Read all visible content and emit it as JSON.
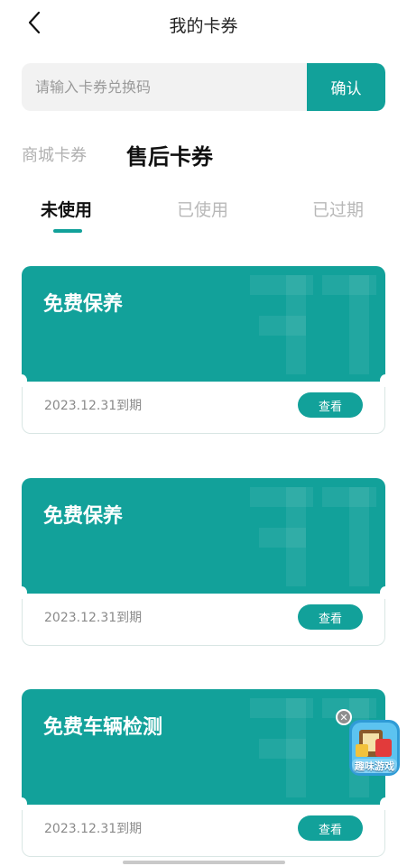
{
  "header": {
    "title": "我的卡券"
  },
  "redeem": {
    "placeholder": "请输入卡券兑换码",
    "confirm_label": "确认"
  },
  "categories": [
    {
      "label": "商城卡券",
      "active": false
    },
    {
      "label": "售后卡券",
      "active": true
    }
  ],
  "status_tabs": [
    {
      "label": "未使用",
      "active": true
    },
    {
      "label": "已使用",
      "active": false
    },
    {
      "label": "已过期",
      "active": false
    }
  ],
  "coupons": [
    {
      "name": "免费保养",
      "expiry": "2023.12.31到期",
      "button": "查看"
    },
    {
      "name": "免费保养",
      "expiry": "2023.12.31到期",
      "button": "查看"
    },
    {
      "name": "免费车辆检测",
      "expiry": "2023.12.31到期",
      "button": "查看"
    }
  ],
  "floating_widget": {
    "label": "趣味游戏",
    "icon": "game-icon"
  },
  "colors": {
    "accent": "#12a19a",
    "text_primary": "#111111",
    "text_muted": "#b0b0b0"
  }
}
